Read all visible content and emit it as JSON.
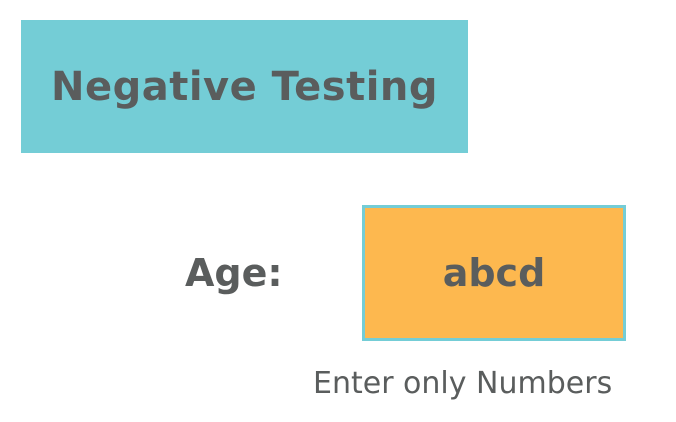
{
  "banner": {
    "title": "Negative Testing",
    "background_color": "#74cdd6"
  },
  "form": {
    "age_label": "Age:",
    "age_value": "abcd",
    "input_background_color": "#fdb84f",
    "input_border_color": "#74cdd6",
    "hint": "Enter only Numbers"
  }
}
